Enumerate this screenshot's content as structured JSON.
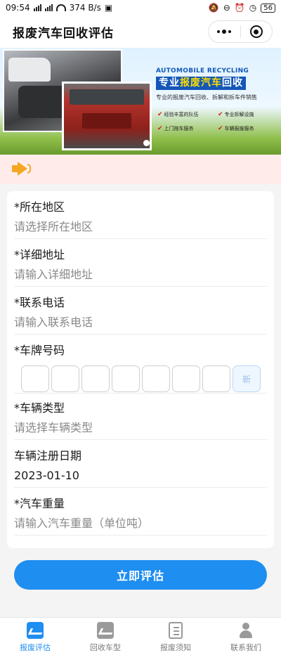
{
  "status": {
    "time": "09:54",
    "net_speed": "374 B/s",
    "battery": "56"
  },
  "nav": {
    "title": "报废汽车回收评估"
  },
  "banner": {
    "en_title": "AUTOMOBILE RECYCLING",
    "title_pre": "专业",
    "title_hl": "报废汽车",
    "title_post": "回收",
    "subtitle": "专业的报废汽车回收、拆解和拆车件销售",
    "features": [
      "经验丰富的队伍",
      "专业拆解设施",
      "上门拖车服务",
      "车辆报废服务"
    ]
  },
  "form": {
    "region": {
      "label": "*所在地区",
      "placeholder": "请选择所在地区"
    },
    "address": {
      "label": "*详细地址",
      "placeholder": "请输入详细地址"
    },
    "phone": {
      "label": "*联系电话",
      "placeholder": "请输入联系电话"
    },
    "plate": {
      "label": "*车牌号码",
      "new_label": "新"
    },
    "vehicle_type": {
      "label": "*车辆类型",
      "placeholder": "请选择车辆类型"
    },
    "reg_date": {
      "label": "车辆注册日期",
      "value": "2023-01-10"
    },
    "weight": {
      "label": "*汽车重量",
      "placeholder": "请输入汽车重量（单位吨）"
    }
  },
  "submit_label": "立即评估",
  "tabs": [
    {
      "label": "报废评估",
      "icon": "chart-icon",
      "active": true
    },
    {
      "label": "回收车型",
      "icon": "chart-icon",
      "active": false
    },
    {
      "label": "报废须知",
      "icon": "document-icon",
      "active": false
    },
    {
      "label": "联系我们",
      "icon": "user-icon",
      "active": false
    }
  ],
  "colors": {
    "accent": "#1e8ef0",
    "notice_bg": "#ffecea",
    "banner_blue": "#1457b8"
  }
}
